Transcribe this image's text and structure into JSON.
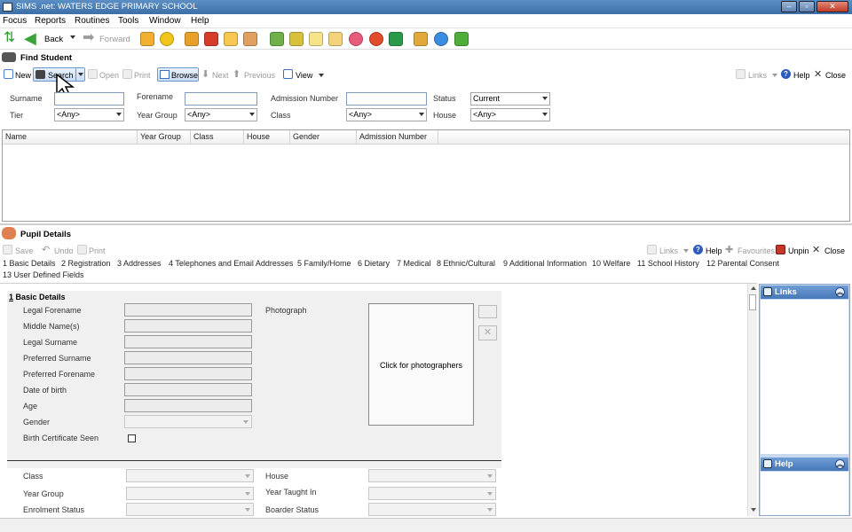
{
  "window": {
    "title": "SIMS .net: WATERS EDGE PRIMARY SCHOOL"
  },
  "menu": [
    "Focus",
    "Reports",
    "Routines",
    "Tools",
    "Window",
    "Help"
  ],
  "toolbar": {
    "back": "Back",
    "forward": "Forward"
  },
  "find": {
    "title": "Find Student",
    "new": "New",
    "search": "Search",
    "open": "Open",
    "print": "Print",
    "browse": "Browse",
    "next": "Next",
    "previous": "Previous",
    "view": "View",
    "links": "Links",
    "help": "Help",
    "close": "Close",
    "labels": {
      "surname": "Surname",
      "forename": "Forename",
      "admission": "Admission Number",
      "status": "Status",
      "tier": "Tier",
      "year_group": "Year Group",
      "class": "Class",
      "house": "House"
    },
    "values": {
      "status": "Current",
      "tier": "<Any>",
      "year_group": "<Any>",
      "class": "<Any>",
      "house": "<Any>"
    },
    "columns": [
      "Name",
      "Year Group",
      "Class",
      "House",
      "Gender",
      "Admission Number"
    ]
  },
  "pupil": {
    "title": "Pupil Details",
    "save": "Save",
    "undo": "Undo",
    "print": "Print",
    "links": "Links",
    "help": "Help",
    "favourites": "Favourites",
    "unpin": "Unpin",
    "close": "Close",
    "tabs": [
      "1 Basic Details",
      "2 Registration",
      "3 Addresses",
      "4 Telephones and Email Addresses",
      "5 Family/Home",
      "6 Dietary",
      "7 Medical",
      "8 Ethnic/Cultural",
      "9 Additional Information",
      "10 Welfare",
      "11 School History",
      "12 Parental Consent",
      "13 User Defined Fields"
    ],
    "basic": {
      "heading_num": "1",
      "heading": " Basic Details",
      "fields": [
        "Legal Forename",
        "Middle Name(s)",
        "Legal Surname",
        "Preferred Surname",
        "Preferred Forename",
        "Date of birth",
        "Age",
        "Gender",
        "Birth Certificate Seen"
      ],
      "photo_label": "Photograph",
      "photo_text": "Click for photographers"
    },
    "registration": {
      "left": [
        "Class",
        "Year Group",
        "Enrolment Status"
      ],
      "right": [
        "House",
        "Year Taught In",
        "Boarder Status"
      ]
    }
  },
  "side": {
    "links": "Links",
    "help": "Help"
  }
}
